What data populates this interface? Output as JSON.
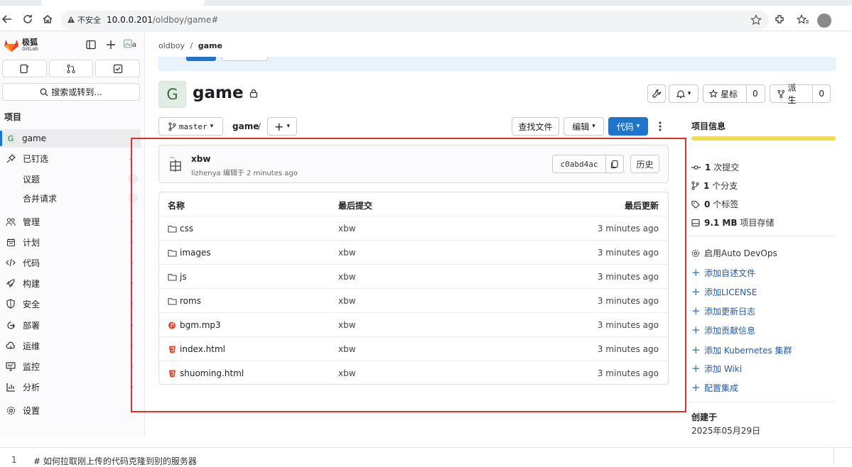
{
  "browser": {
    "security_label": "不安全",
    "url_host": "10.0.0.201",
    "url_path": "/oldboy/game#"
  },
  "brand": {
    "name": "极狐",
    "sub": "GitLab"
  },
  "sidebar": {
    "search_label": "搜索或转到...",
    "section_title": "项目",
    "project": {
      "badge": "G",
      "label": "game"
    },
    "items": [
      {
        "label": "已钉选"
      },
      {
        "label": "议题"
      },
      {
        "label": "合并请求"
      },
      {
        "label": "管理"
      },
      {
        "label": "计划"
      },
      {
        "label": "代码"
      },
      {
        "label": "构建"
      },
      {
        "label": "安全"
      },
      {
        "label": "部署"
      },
      {
        "label": "运维"
      },
      {
        "label": "监控"
      },
      {
        "label": "分析"
      },
      {
        "label": "设置"
      }
    ]
  },
  "breadcrumb": {
    "group": "oldboy",
    "sep": "/",
    "project": "game"
  },
  "project": {
    "avatar_letter": "G",
    "name": "game",
    "star_label": "星标",
    "star_count": "0",
    "fork_label": "派生",
    "fork_count": "0"
  },
  "toolbar": {
    "branch": "master",
    "repo": "game",
    "slash": "/",
    "add": "+",
    "find_file": "查找文件",
    "edit": "编辑",
    "code": "代码"
  },
  "commit": {
    "title": "xbw",
    "meta": "lizhenya 编辑于 2 minutes ago",
    "sha": "c0abd4ac",
    "history": "历史"
  },
  "files": {
    "headers": {
      "name": "名称",
      "last_commit": "最后提交",
      "last_update": "最后更新"
    },
    "rows": [
      {
        "name": "css",
        "type": "folder",
        "commit": "xbw",
        "date": "3 minutes ago"
      },
      {
        "name": "images",
        "type": "folder",
        "commit": "xbw",
        "date": "3 minutes ago"
      },
      {
        "name": "js",
        "type": "folder",
        "commit": "xbw",
        "date": "3 minutes ago"
      },
      {
        "name": "roms",
        "type": "folder",
        "commit": "xbw",
        "date": "3 minutes ago"
      },
      {
        "name": "bgm.mp3",
        "type": "audio",
        "commit": "xbw",
        "date": "3 minutes ago"
      },
      {
        "name": "index.html",
        "type": "html",
        "commit": "xbw",
        "date": "3 minutes ago"
      },
      {
        "name": "shuoming.html",
        "type": "html",
        "commit": "xbw",
        "date": "3 minutes ago"
      }
    ]
  },
  "info": {
    "title": "项目信息",
    "commits_num": "1",
    "commits_label": "次提交",
    "branches_num": "1",
    "branches_label": "个分支",
    "tags_num": "0",
    "tags_label": "个标签",
    "storage_num": "9.1 MB",
    "storage_label": "项目存储",
    "links": [
      "启用Auto DevOps",
      "添加自述文件",
      "添加LICENSE",
      "添加更新日志",
      "添加贡献信息",
      "添加 Kubernetes 集群",
      "添加 Wiki",
      "配置集成"
    ],
    "created_label": "创建于",
    "created_date": "2025年05月29日"
  },
  "bottom": {
    "line_no": "1",
    "text": "# 如何拉取刚上传的代码克隆到别的服务器"
  },
  "colors": {
    "primary": "#1f75cb",
    "highlight": "#e03030",
    "storage_bar": "#f3d94f"
  }
}
